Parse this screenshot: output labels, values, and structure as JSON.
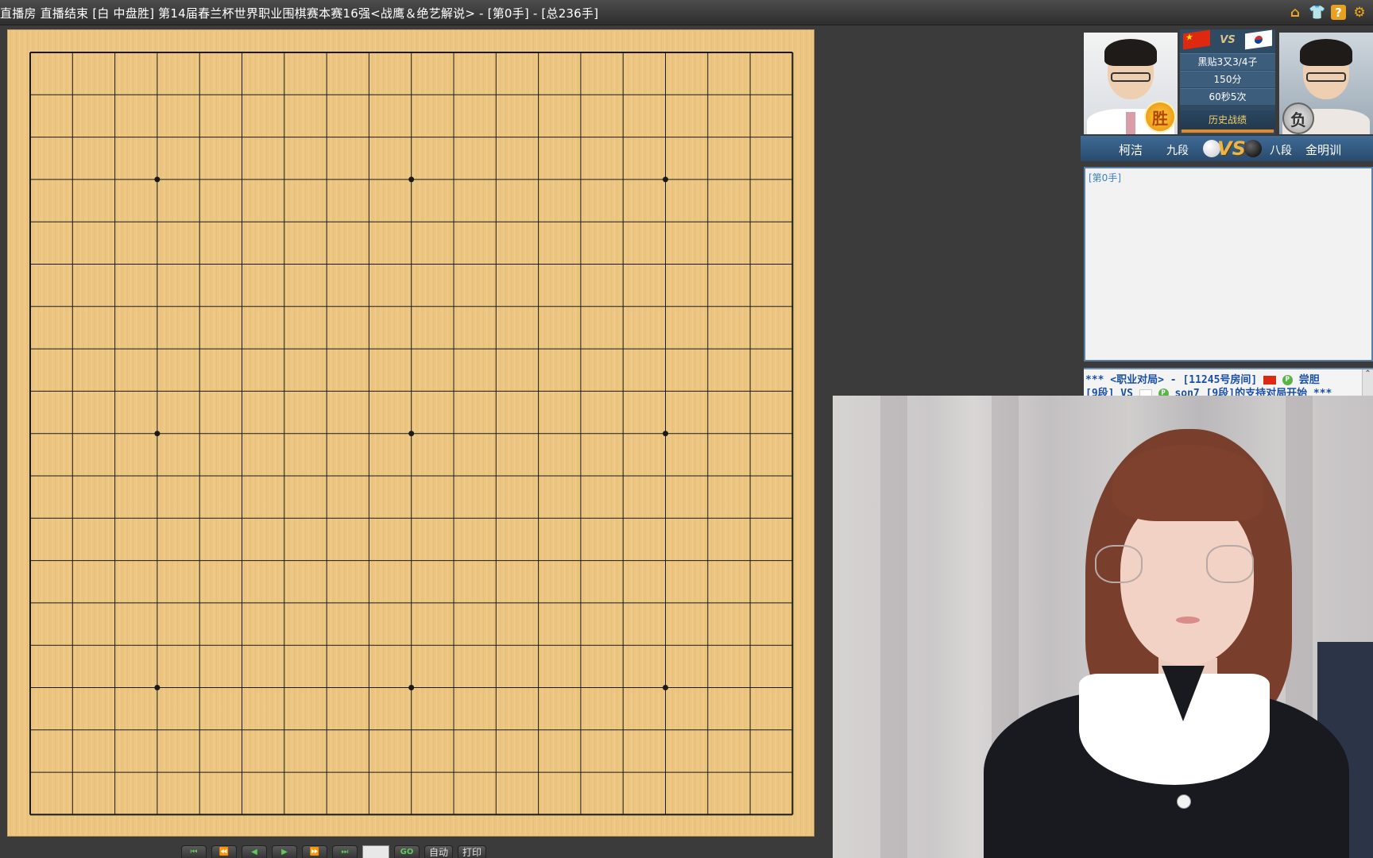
{
  "window": {
    "title": "直播房 直播结束 [白 中盘胜] 第14届春兰杯世界职业围棋赛本赛16强<战鹰＆绝艺解说> - [第0手] - [总236手]"
  },
  "toolbar_icons": [
    "home-icon",
    "shirt-icon",
    "help-icon",
    "gear-icon"
  ],
  "board": {
    "size": 19,
    "hoshi": [
      [
        3,
        3
      ],
      [
        3,
        9
      ],
      [
        3,
        15
      ],
      [
        9,
        3
      ],
      [
        9,
        9
      ],
      [
        9,
        15
      ],
      [
        15,
        3
      ],
      [
        15,
        9
      ],
      [
        15,
        15
      ]
    ],
    "board_color": "#ecc681",
    "line_color": "#1a1a1a"
  },
  "controls": {
    "buttons": [
      "first-move",
      "back-10",
      "back-1",
      "play",
      "forward-10",
      "last-move"
    ],
    "go_label": "GO",
    "auto_label": "自动",
    "print_label": "打印",
    "move_input_value": ""
  },
  "match": {
    "komi": "黑贴3又3/4子",
    "points": "150分",
    "byoyomi": "60秒5次",
    "history_label": "历史战绩",
    "white_player": {
      "name": "柯洁",
      "rank": "九段",
      "result_badge": "胜",
      "country": "CN"
    },
    "black_player": {
      "name": "金明训",
      "rank": "八段",
      "result_badge": "负",
      "country": "KR"
    },
    "vs_small": "VS",
    "vs_big": "VS"
  },
  "move_log": {
    "current": "[第0手]"
  },
  "chat": {
    "line1_prefix": "*** <职业对局> - [11245号房间]",
    "line1_user": "尝胆",
    "line2_prefix": "[9段] VS",
    "line2_user": "son7",
    "line2_suffix": "[9段]的支持对局开始 ***"
  },
  "colors": {
    "accent_orange": "#f2a81a",
    "panel_blue": "#2f4a63",
    "link_blue": "#1a4fa6"
  }
}
